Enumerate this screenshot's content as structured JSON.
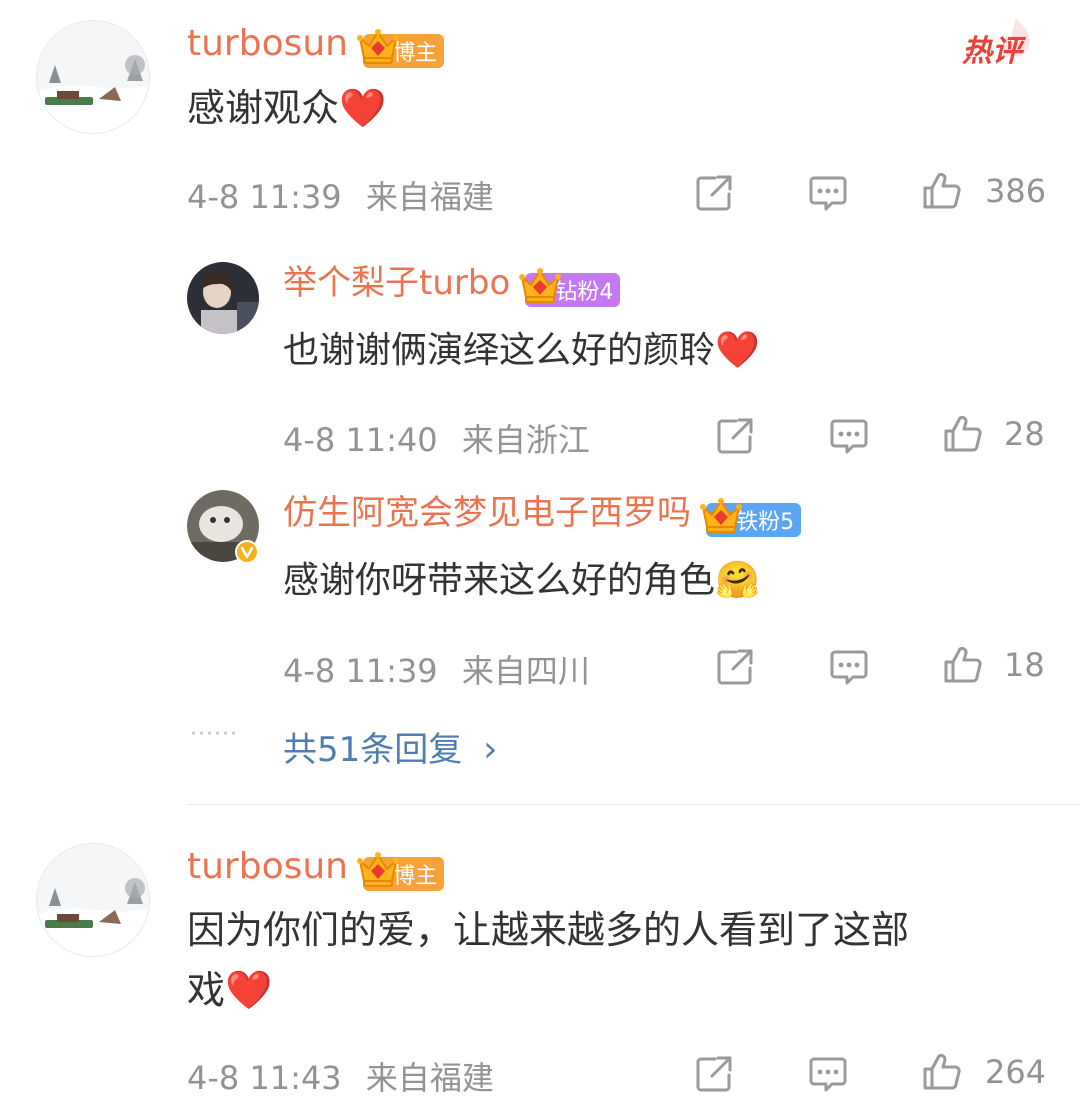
{
  "hot_tag": "热评",
  "comments": [
    {
      "username": "turbosun",
      "badge": "博主",
      "text": "感谢观众",
      "emoji": "❤️",
      "time": "4-8 11:39",
      "location": "来自福建",
      "likes": "386"
    },
    {
      "username": "turbosun",
      "badge": "博主",
      "text_line1": "因为你们的爱，让越来越多的人看到了这部",
      "text_line2": "戏",
      "emoji": "❤️",
      "time": "4-8 11:43",
      "location": "来自福建",
      "likes": "264"
    }
  ],
  "replies": [
    {
      "username": "举个梨子turbo",
      "badge": "钻粉4",
      "badge_color": "#c479f0",
      "text": "也谢谢俩演绎这么好的颜聆",
      "emoji": "❤️",
      "time": "4-8 11:40",
      "location": "来自浙江",
      "likes": "28"
    },
    {
      "username": "仿生阿宽会梦见电子西罗吗",
      "badge": "铁粉5",
      "badge_color": "#5aa6f5",
      "text": "感谢你呀带来这么好的角色",
      "emoji": "🤗",
      "time": "4-8 11:39",
      "location": "来自四川",
      "likes": "18"
    }
  ],
  "more_replies": {
    "dots": "······",
    "label": "共51条回复",
    "chevron": "›"
  },
  "colors": {
    "username": "#eb7350",
    "link": "#507daf",
    "meta": "#939393",
    "blogger_badge": "#f6a23a"
  },
  "icons": [
    "share-icon",
    "comment-icon",
    "like-icon",
    "crown-icon",
    "verified-icon"
  ]
}
